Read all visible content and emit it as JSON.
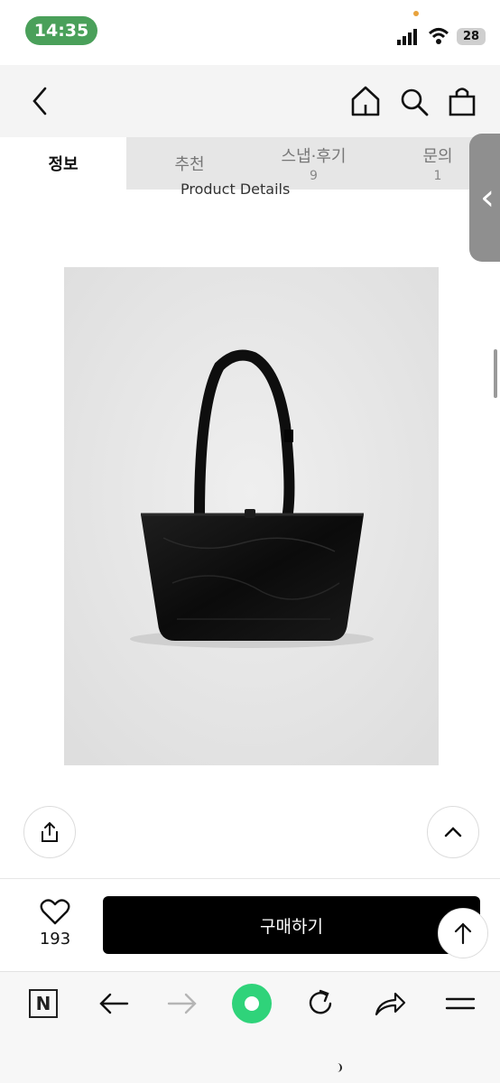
{
  "status_bar": {
    "time": "14:35",
    "battery": "28"
  },
  "tabs": [
    {
      "label": "정보",
      "count": ""
    },
    {
      "label": "추천",
      "count": ""
    },
    {
      "label": "스냅·후기",
      "count": "9"
    },
    {
      "label": "문의",
      "count": "1"
    }
  ],
  "content": {
    "section_heading": "Product Details"
  },
  "purchase": {
    "wish_count": "193",
    "buy_label": "구매하기"
  },
  "icons": {
    "header": [
      "back-icon",
      "home-icon",
      "search-icon",
      "bag-icon"
    ],
    "toolbar": [
      "naver-icon",
      "back-arrow-icon",
      "forward-arrow-icon",
      "green-dot-icon",
      "refresh-icon",
      "share-arrow-icon",
      "menu-icon"
    ]
  },
  "colors": {
    "clock_bg": "#4aa05a",
    "buy_button": "#000000",
    "green_dot": "#2fd37a"
  }
}
